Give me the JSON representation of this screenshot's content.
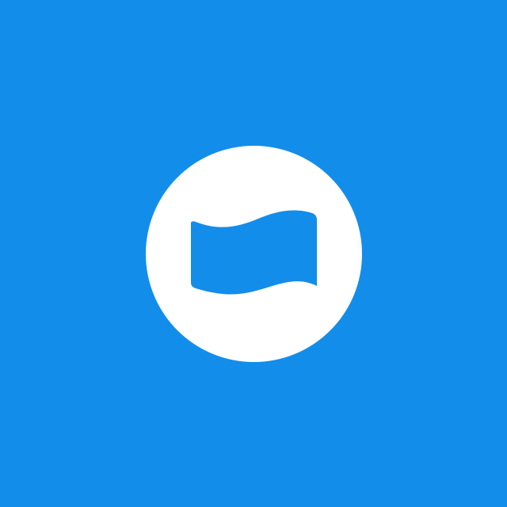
{
  "screen": {
    "background_color": "#138DEA"
  },
  "logo": {
    "circle_color": "#FFFFFF",
    "icon_name": "wavy-flag-icon",
    "icon_color": "#138DEA"
  }
}
